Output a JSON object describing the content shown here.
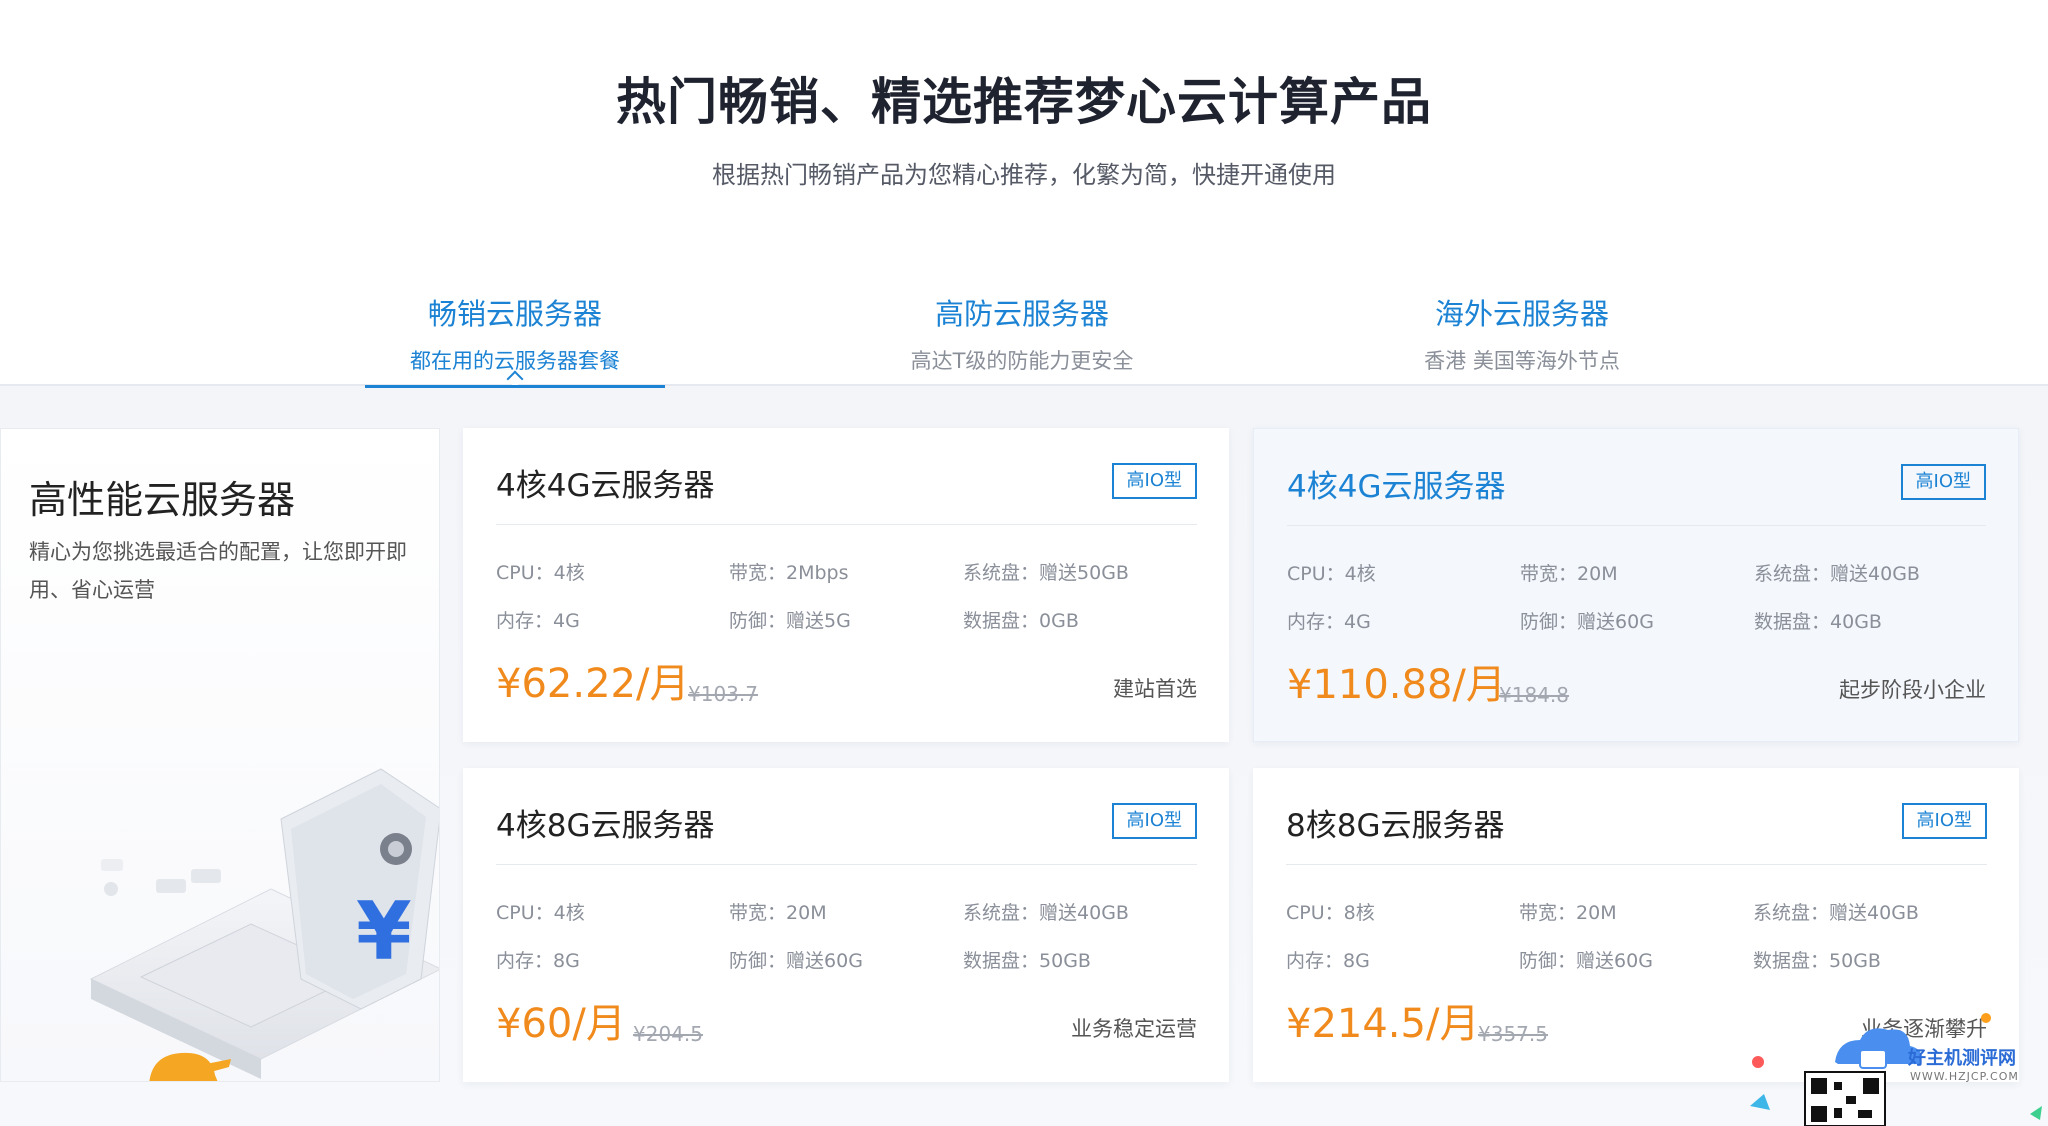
{
  "header": {
    "title": "热门畅销、精选推荐梦心云计算产品",
    "subtitle": "根据热门畅销产品为您精心推荐，化繁为简，快捷开通使用"
  },
  "tabs": [
    {
      "title": "畅销云服务器",
      "subtitle": "都在用的云服务器套餐",
      "active": true
    },
    {
      "title": "高防云服务器",
      "subtitle": "高达T级的防能力更安全",
      "active": false
    },
    {
      "title": "海外云服务器",
      "subtitle": "香港 美国等海外节点",
      "active": false
    }
  ],
  "promo": {
    "title": "高性能云服务器",
    "description": "精心为您挑选最适合的配置，让您即开即用、省心运营"
  },
  "products": [
    {
      "title": "4核4G云服务器",
      "badge": "高IO型",
      "specs": [
        {
          "label": "CPU：",
          "value": "4核"
        },
        {
          "label": "带宽：",
          "value": "2Mbps"
        },
        {
          "label": "系统盘：",
          "value": "赠送50GB"
        },
        {
          "label": "内存：",
          "value": "4G"
        },
        {
          "label": "防御：",
          "value": "赠送5G"
        },
        {
          "label": "数据盘：",
          "value": "0GB"
        }
      ],
      "price": "¥62.22/月",
      "original_price": "¥103.7",
      "tag": "建站首选"
    },
    {
      "title": "4核4G云服务器",
      "badge": "高IO型",
      "specs": [
        {
          "label": "CPU：",
          "value": "4核"
        },
        {
          "label": "带宽：",
          "value": "20M"
        },
        {
          "label": "系统盘：",
          "value": "赠送40GB"
        },
        {
          "label": "内存：",
          "value": "4G"
        },
        {
          "label": "防御：",
          "value": "赠送60G"
        },
        {
          "label": "数据盘：",
          "value": "40GB"
        }
      ],
      "price": "¥110.88/月",
      "original_price": "¥184.8",
      "tag": "起步阶段小企业"
    },
    {
      "title": "4核8G云服务器",
      "badge": "高IO型",
      "specs": [
        {
          "label": "CPU：",
          "value": "4核"
        },
        {
          "label": "带宽：",
          "value": "20M"
        },
        {
          "label": "系统盘：",
          "value": "赠送40GB"
        },
        {
          "label": "内存：",
          "value": "8G"
        },
        {
          "label": "防御：",
          "value": "赠送60G"
        },
        {
          "label": "数据盘：",
          "value": "50GB"
        }
      ],
      "price": "¥60/月",
      "original_price": "¥204.5",
      "tag": "业务稳定运营"
    },
    {
      "title": "8核8G云服务器",
      "badge": "高IO型",
      "specs": [
        {
          "label": "CPU：",
          "value": "8核"
        },
        {
          "label": "带宽：",
          "value": "20M"
        },
        {
          "label": "系统盘：",
          "value": "赠送40GB"
        },
        {
          "label": "内存：",
          "value": "8G"
        },
        {
          "label": "防御：",
          "value": "赠送60G"
        },
        {
          "label": "数据盘：",
          "value": "50GB"
        }
      ],
      "price": "¥214.5/月",
      "original_price": "¥357.5",
      "tag": "业务逐渐攀升"
    }
  ],
  "watermark": {
    "text": "好主机测评网",
    "url": "WWW.HZJCP.COM"
  },
  "colors": {
    "accent": "#1c83d4",
    "price": "#f08a1c",
    "title": "#1f2330"
  }
}
